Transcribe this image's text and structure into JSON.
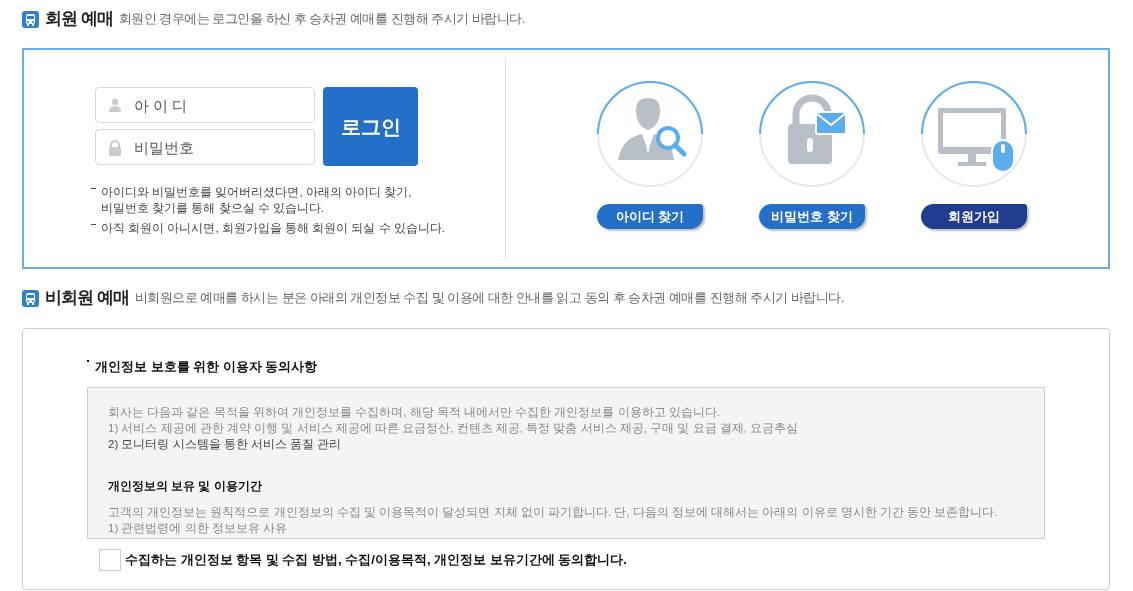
{
  "member_section": {
    "title": "회원 예매",
    "description": "회원인 경우에는 로그인을 하신 후 승차권 예매를 진행해 주시기 바랍니다.",
    "login": {
      "id_placeholder": "아 이 디",
      "password_placeholder": "비밀번호",
      "button": "로그인"
    },
    "notes": [
      [
        "아이디와 비밀번호를 잊어버리셨다면, 아래의 아이디 찾기,",
        "비밀번호 찾기를 통해 찾으실 수 있습니다."
      ],
      [
        "아직 회원이 아니시면, 회원가입을 통해 회원이 되실 수 있습니다."
      ]
    ],
    "actions": [
      {
        "kind": "find-id",
        "label": "아이디 찾기"
      },
      {
        "kind": "find-password",
        "label": "비밀번호 찾기"
      },
      {
        "kind": "join",
        "label": "회원가입"
      }
    ]
  },
  "guest_section": {
    "title": "비회원 예매",
    "description": "비회원으로 예매를 하시는 분은 아래의 개인정보 수집 및 이용에 대한 안내를 읽고 동의 후 승차권 예매를  진행해 주시기 바랍니다.",
    "consent_title": "개인정보 보호를 위한 이용자 동의사항",
    "terms": [
      {
        "kind": "text",
        "text": "회사는 다음과 같은 목적을 위하여 개인정보를 수집하며, 해당 목적 내에서만 수집한 개인정보를 이용하고 있습니다."
      },
      {
        "kind": "text",
        "text": "1) 서비스 제공에 관한 계약 이행 및 서비스 제공에 따른 요금정산, 컨텐츠 제공, 특정 맞춤 서비스 제공, 구매 및 요금 결제, 요금추심"
      },
      {
        "kind": "dark-text",
        "text": "2) 모니터링 시스템을 통한 서비스 품질 관리"
      },
      {
        "kind": "heading",
        "text": "개인정보의 보유 및 이용기간"
      },
      {
        "kind": "text",
        "text": "고객의 개인정보는 원칙적으로 개인정보의 수집 및 이용목적이 달성되면 지체 없이 파기합니다. 단, 다음의 정보에 대해서는 아래의 이유로 명시한 기간 동안 보존합니다."
      },
      {
        "kind": "text",
        "text": "1) 관련법령에 의한 정보보유 사유"
      }
    ],
    "agree": {
      "label": "수집하는 개인정보 항목 및 수집 방법, 수집/이용목적, 개인정보 보유기간에 동의합니다.",
      "checked": false
    }
  }
}
